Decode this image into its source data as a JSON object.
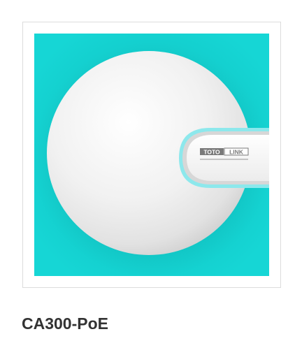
{
  "product": {
    "title": "CA300-PoE",
    "brand_logo_text": "TOTOLINK",
    "background_color": "#14d3d2",
    "device_color": "#f2f2f2",
    "accent_color": "#6ae3ea"
  }
}
